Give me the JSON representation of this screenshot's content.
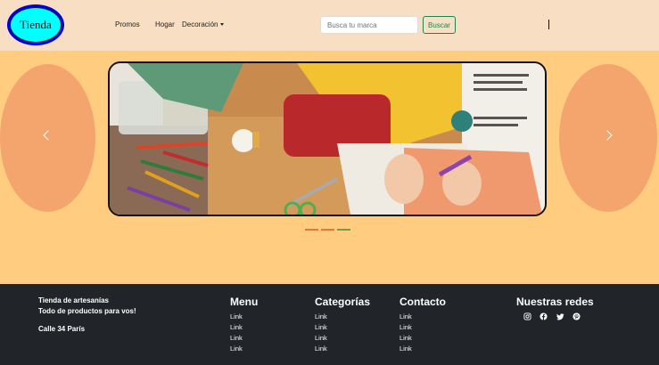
{
  "header": {
    "logo_text": "Tienda",
    "nav": [
      {
        "label": "Promos"
      },
      {
        "label": "Hogar"
      },
      {
        "label": "Decoración"
      }
    ],
    "search_placeholder": "Busca tu marca",
    "search_button": "Buscar"
  },
  "carousel": {
    "prev_icon": "chevron-left-icon",
    "next_icon": "chevron-right-icon",
    "indicator_colors": [
      "#e07a3a",
      "#e07a3a",
      "#7a9a4a"
    ]
  },
  "footer": {
    "about_line1": "Tienda de artesanías",
    "about_line2": "Todo de productos para vos!",
    "address": "Calle 34 París",
    "menu": {
      "title": "Menu",
      "links": [
        "Link",
        "Link",
        "Link",
        "Link"
      ]
    },
    "categorias": {
      "title": "Categorías",
      "links": [
        "Link",
        "Link",
        "Link",
        "Link"
      ]
    },
    "contacto": {
      "title": "Contacto",
      "links": [
        "Link",
        "Link",
        "Link",
        "Link"
      ]
    },
    "redes": {
      "title": "Nuestras redes",
      "icons": [
        "instagram-icon",
        "facebook-icon",
        "twitter-icon",
        "pinterest-icon"
      ]
    }
  },
  "colors": {
    "header_bg": "#f8dfc3",
    "page_bg": "#ffcc80",
    "footer_bg": "#212529",
    "accent_green": "#198754"
  }
}
